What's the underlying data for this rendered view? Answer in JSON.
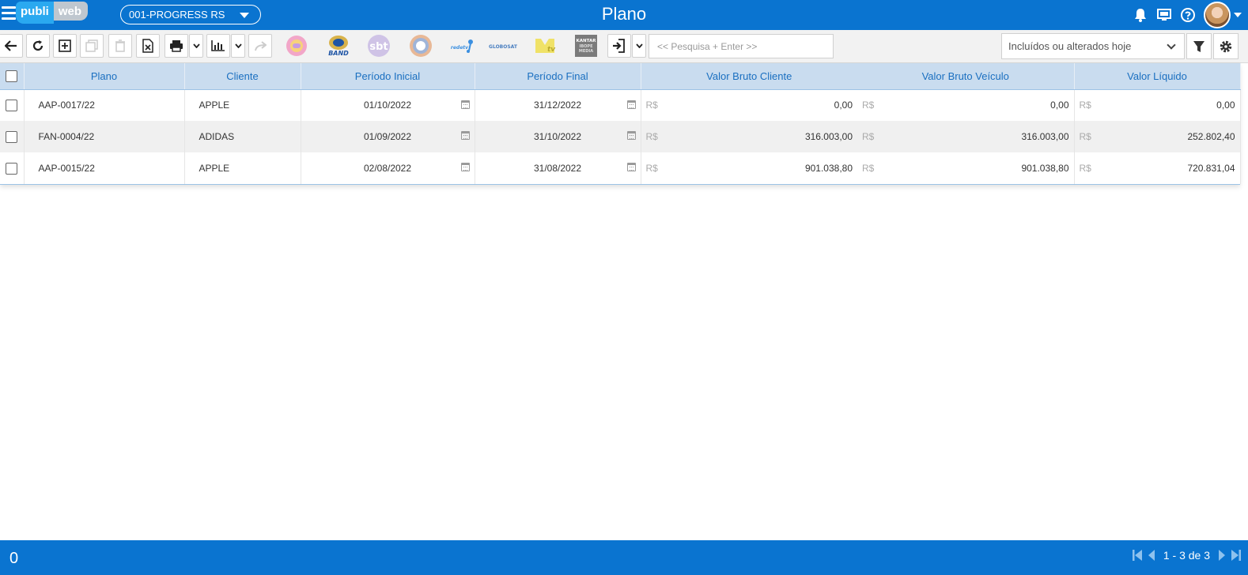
{
  "header": {
    "logo_left": "publi",
    "logo_right": "web",
    "company": "001-PROGRESS RS",
    "title": "Plano"
  },
  "toolbar": {
    "channels": [
      "globo",
      "BAND",
      "sbt",
      "record",
      "redetv",
      "GLOBOSAT",
      "MTV",
      "KANTAR IBOPE MEDIA"
    ],
    "search_placeholder": "<< Pesquisa + Enter >>",
    "filter_value": "Incluídos ou alterados hoje"
  },
  "table": {
    "columns": [
      "Plano",
      "Cliente",
      "Período Inicial",
      "Período Final",
      "Valor Bruto Cliente",
      "Valor Bruto Veículo",
      "Valor Líquido"
    ],
    "currency": "R$",
    "rows": [
      {
        "plano": "AAP-0017/22",
        "cliente": "APPLE",
        "inicio": "01/10/2022",
        "fim": "31/12/2022",
        "bruto_cliente": "0,00",
        "bruto_veiculo": "0,00",
        "liquido": "0,00"
      },
      {
        "plano": "FAN-0004/22",
        "cliente": "ADIDAS",
        "inicio": "01/09/2022",
        "fim": "31/10/2022",
        "bruto_cliente": "316.003,00",
        "bruto_veiculo": "316.003,00",
        "liquido": "252.802,40"
      },
      {
        "plano": "AAP-0015/22",
        "cliente": "APPLE",
        "inicio": "02/08/2022",
        "fim": "31/08/2022",
        "bruto_cliente": "901.038,80",
        "bruto_veiculo": "901.038,80",
        "liquido": "720.831,04"
      }
    ]
  },
  "footer": {
    "selected_count": "0",
    "pager_text": "1 - 3 de 3"
  },
  "colors": {
    "primary": "#0a74d0",
    "header_row": "#c9dcef",
    "header_text": "#1a6fc0"
  }
}
